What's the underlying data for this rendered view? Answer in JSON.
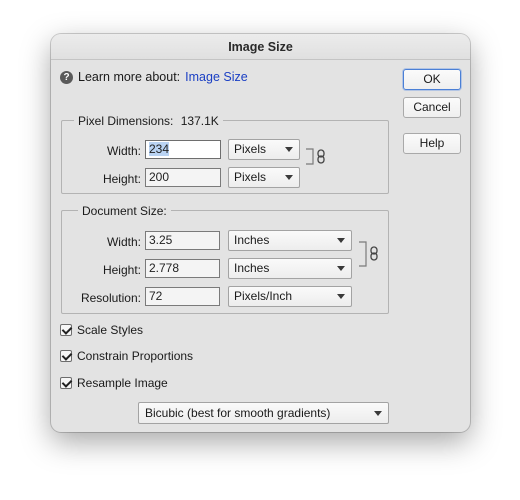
{
  "dialog": {
    "title": "Image Size",
    "learn_more_prefix": "Learn more about:",
    "learn_more_link": "Image Size"
  },
  "buttons": {
    "ok": "OK",
    "cancel": "Cancel",
    "help": "Help"
  },
  "pixel_dimensions": {
    "label": "Pixel Dimensions:",
    "size": "137.1K",
    "width_label": "Width:",
    "width_value": "234",
    "width_unit": "Pixels",
    "height_label": "Height:",
    "height_value": "200",
    "height_unit": "Pixels"
  },
  "document_size": {
    "label": "Document Size:",
    "width_label": "Width:",
    "width_value": "3.25",
    "width_unit": "Inches",
    "height_label": "Height:",
    "height_value": "2.778",
    "height_unit": "Inches",
    "resolution_label": "Resolution:",
    "resolution_value": "72",
    "resolution_unit": "Pixels/Inch"
  },
  "options": {
    "scale_styles": "Scale Styles",
    "constrain_proportions": "Constrain Proportions",
    "resample_image": "Resample Image",
    "resample_method": "Bicubic (best for smooth gradients)"
  },
  "icons": {
    "help": "help-circle-icon",
    "link": "chain-link-icon",
    "dropdown": "chevron-down-icon"
  },
  "colors": {
    "link": "#1a3fc4",
    "selection": "#b9d3f3",
    "default_button_border": "#4a7fd6"
  }
}
